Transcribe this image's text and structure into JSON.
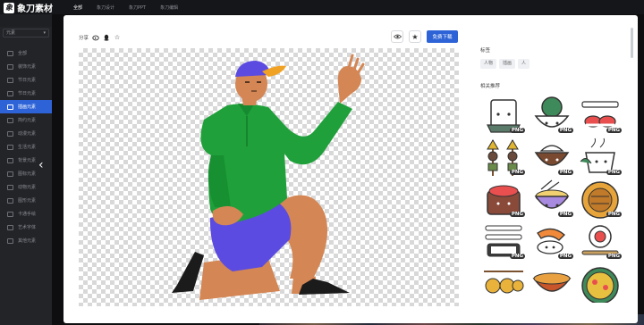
{
  "app": {
    "name": "象刀素材"
  },
  "topnav": {
    "items": [
      "全部",
      "象刀设计",
      "象刀PPT",
      "象刀编辑"
    ]
  },
  "sidebar": {
    "filter_label": "元素",
    "items": [
      {
        "label": "全部",
        "active": false
      },
      {
        "label": "装饰元素",
        "active": false
      },
      {
        "label": "节日元素",
        "active": false
      },
      {
        "label": "节日元素",
        "active": false
      },
      {
        "label": "插画元素",
        "active": true
      },
      {
        "label": "简约元素",
        "active": false
      },
      {
        "label": "动漫元素",
        "active": false
      },
      {
        "label": "生活元素",
        "active": false
      },
      {
        "label": "背景元素",
        "active": false
      },
      {
        "label": "图标元素",
        "active": false
      },
      {
        "label": "动物元素",
        "active": false
      },
      {
        "label": "图形元素",
        "active": false
      },
      {
        "label": "卡通手绘",
        "active": false
      },
      {
        "label": "艺术字体",
        "active": false
      },
      {
        "label": "其他元素",
        "active": false
      }
    ]
  },
  "modal": {
    "share_label": "分享",
    "share_icons": [
      "weibo-icon",
      "qq-icon",
      "star-icon"
    ],
    "download_label": "免费下载",
    "icons": {
      "preview": "eye-icon",
      "favorite": "star-icon"
    },
    "tags_title": "标签",
    "tags": [
      "人物",
      "插画",
      "人"
    ],
    "recommend_title": "相关推荐",
    "badge": "PNG",
    "thumbs": [
      "tofu-character",
      "broccoli-bowl",
      "sushi-plate",
      "oden-skewers",
      "rice-bowl",
      "teacup-plant",
      "salmon-roe-block",
      "ramen-bowl",
      "round-pie",
      "sushi-roll",
      "shrimp-sushi",
      "tempura-plate",
      "takoyaki-skewer",
      "miso-soup",
      "paella"
    ]
  },
  "colors": {
    "accent": "#2d63d6",
    "shirt": "#1fa03a",
    "shorts": "#5b4be0",
    "cap": "#f0a225",
    "skin": "#d48654"
  }
}
